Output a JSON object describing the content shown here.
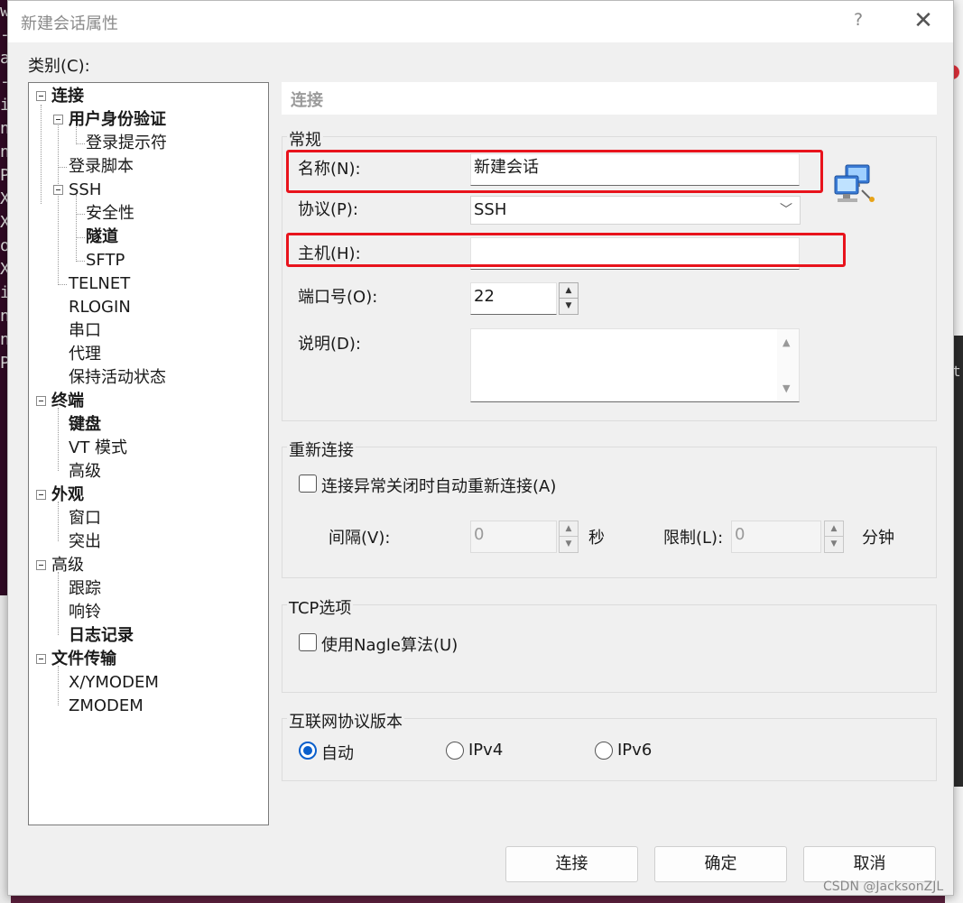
{
  "background": {
    "terminal_chars": [
      "w",
      "-",
      "a",
      "-",
      "i",
      "n",
      "n",
      "P",
      "X",
      "X",
      "o",
      "X",
      "i",
      "n",
      "n",
      "P"
    ],
    "right_char": "t",
    "accent_red": "#e0313b"
  },
  "dialog": {
    "title": "新建会话属性",
    "help_label": "?",
    "close_label": "✕",
    "category_label": "类别(C):"
  },
  "tree": [
    {
      "label": "连接"
    },
    {
      "label": "用户身份验证"
    },
    {
      "label": "登录提示符"
    },
    {
      "label": "登录脚本"
    },
    {
      "label": "SSH"
    },
    {
      "label": "安全性"
    },
    {
      "label": "隧道"
    },
    {
      "label": "SFTP"
    },
    {
      "label": "TELNET"
    },
    {
      "label": "RLOGIN"
    },
    {
      "label": "串口"
    },
    {
      "label": "代理"
    },
    {
      "label": "保持活动状态"
    },
    {
      "label": "终端"
    },
    {
      "label": "键盘"
    },
    {
      "label": "VT 模式"
    },
    {
      "label": "高级"
    },
    {
      "label": "外观"
    },
    {
      "label": "窗口"
    },
    {
      "label": "突出"
    },
    {
      "label": "高级"
    },
    {
      "label": "跟踪"
    },
    {
      "label": "响铃"
    },
    {
      "label": "日志记录"
    },
    {
      "label": "文件传输"
    },
    {
      "label": "X/YMODEM"
    },
    {
      "label": "ZMODEM"
    }
  ],
  "panel": {
    "header": "连接",
    "general": {
      "title": "常规",
      "name_label": "名称(N):",
      "name_value": "新建会话",
      "protocol_label": "协议(P):",
      "protocol_value": "SSH",
      "host_label": "主机(H):",
      "host_value": "",
      "port_label": "端口号(O):",
      "port_value": "22",
      "desc_label": "说明(D):",
      "desc_value": ""
    },
    "reconnect": {
      "title": "重新连接",
      "auto_label": "连接异常关闭时自动重新连接(A)",
      "interval_label": "间隔(V):",
      "interval_value": "0",
      "interval_unit": "秒",
      "limit_label": "限制(L):",
      "limit_value": "0",
      "limit_unit": "分钟"
    },
    "tcp": {
      "title": "TCP选项",
      "nagle_label": "使用Nagle算法(U)"
    },
    "ip": {
      "title": "互联网协议版本",
      "auto": "自动",
      "ipv4": "IPv4",
      "ipv6": "IPv6",
      "selected": "自动"
    }
  },
  "buttons": {
    "connect": "连接",
    "ok": "确定",
    "cancel": "取消"
  },
  "watermark": "CSDN @JacksonZJL",
  "colors": {
    "highlight_box": "#e8131c",
    "radio_selected": "#0a5fcc"
  }
}
